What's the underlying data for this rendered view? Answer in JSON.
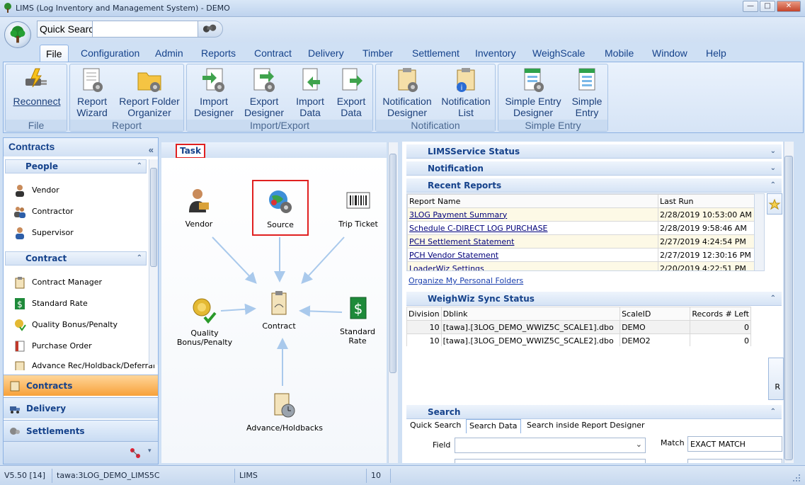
{
  "window": {
    "title": "LIMS (Log Inventory and Management System) - DEMO",
    "min": "—",
    "max": "□",
    "close": "✕"
  },
  "quick_search": {
    "label": "Quick Searc",
    "value": ""
  },
  "menu": [
    "File",
    "Configuration",
    "Admin",
    "Reports",
    "Contract",
    "Delivery",
    "Timber",
    "Settlement",
    "Inventory",
    "WeighScale",
    "Mobile",
    "Window",
    "Help"
  ],
  "ribbon": {
    "groups": [
      {
        "label": "File",
        "buttons": [
          [
            "Reconnect"
          ]
        ]
      },
      {
        "label": "Report",
        "buttons": [
          [
            "Report",
            "Wizard"
          ],
          [
            "Report Folder",
            "Organizer"
          ]
        ]
      },
      {
        "label": "Import/Export",
        "buttons": [
          [
            "Import",
            "Designer"
          ],
          [
            "Export",
            "Designer"
          ],
          [
            "Import",
            "Data"
          ],
          [
            "Export",
            "Data"
          ]
        ]
      },
      {
        "label": "Notification",
        "buttons": [
          [
            "Notification",
            "Designer"
          ],
          [
            "Notification",
            "List"
          ]
        ]
      },
      {
        "label": "Simple Entry",
        "buttons": [
          [
            "Simple Entry",
            "Designer"
          ],
          [
            "Simple",
            "Entry"
          ]
        ]
      }
    ]
  },
  "left": {
    "title": "Contracts",
    "collapse": "«",
    "people_header": "People",
    "people": [
      "Vendor",
      "Contractor",
      "Supervisor"
    ],
    "contract_header": "Contract",
    "contract_items": [
      "Contract Manager",
      "Standard Rate",
      "Quality Bonus/Penalty",
      "Purchase Order",
      "Advance Rec/Holdback/Deferral"
    ],
    "nav": [
      "Contracts",
      "Delivery",
      "Settlements"
    ]
  },
  "task": {
    "title": "Task",
    "nodes": {
      "vendor": "Vendor",
      "source": "Source",
      "trip": "Trip Ticket",
      "quality": "Quality Bonus/Penalty",
      "contract": "Contract",
      "standard": "Standard Rate",
      "advance": "Advance/Holdbacks"
    }
  },
  "right": {
    "service_status": "LIMSService Status",
    "notification": "Notification",
    "recent_reports": "Recent Reports",
    "report_cols": [
      "Report Name",
      "Last Run"
    ],
    "reports": [
      [
        "3LOG Payment Summary",
        "2/28/2019 10:53:00 AM"
      ],
      [
        "Schedule C-DIRECT LOG PURCHASE",
        "2/28/2019 9:58:46 AM"
      ],
      [
        "PCH Settlement Statement",
        "2/27/2019 4:24:54 PM"
      ],
      [
        "PCH Vendor Statement",
        "2/27/2019 12:30:16 PM"
      ],
      [
        "LoaderWiz Settings",
        "2/20/2019 4:22:51 PM"
      ]
    ],
    "organize_link": "Organize My Personal Folders",
    "weighwiz": "WeighWiz Sync Status",
    "ww_cols": [
      "Division",
      "Dblink",
      "ScaleID",
      "Records # Left"
    ],
    "ww_rows": [
      [
        "10",
        "[tawa].[3LOG_DEMO_WWIZ5C_SCALE1].dbo",
        "DEMO",
        "0"
      ],
      [
        "10",
        "[tawa].[3LOG_DEMO_WWIZ5C_SCALE2].dbo",
        "DEMO2",
        "0"
      ]
    ],
    "search": "Search",
    "search_tabs": [
      "Quick Search",
      "Search Data",
      "Search inside Report Designer"
    ],
    "field_label": "Field",
    "match_label": "Match",
    "match_value": "EXACT MATCH",
    "side_btn": "R"
  },
  "status": {
    "version": "V5.50 [14]",
    "db": "tawa:3LOG_DEMO_LIMS5C",
    "app": "LIMS",
    "num": "10"
  }
}
